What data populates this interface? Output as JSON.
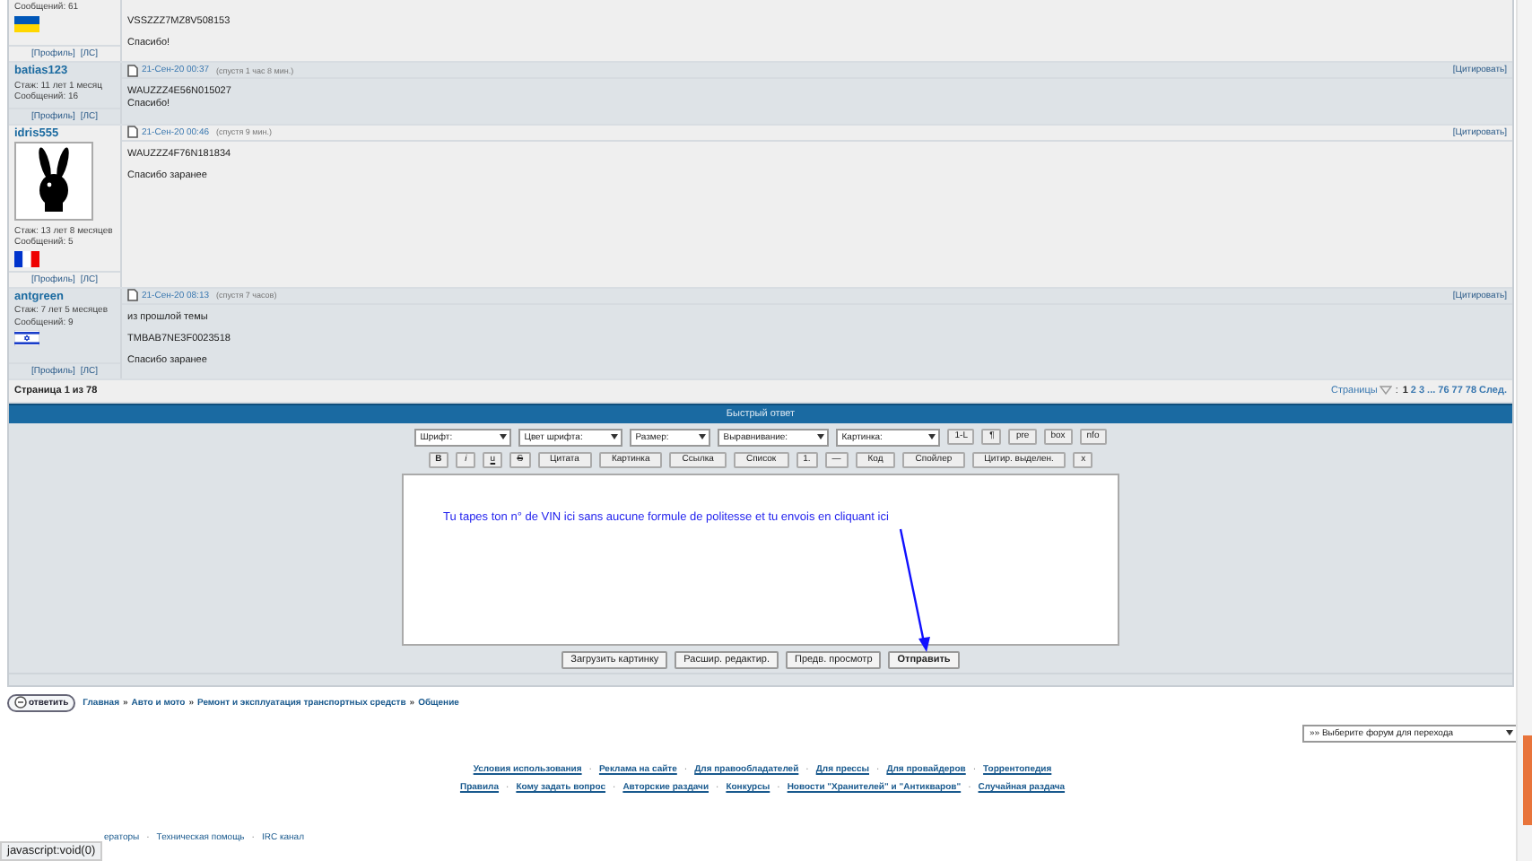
{
  "posts": [
    {
      "stats": [
        "Сообщений: 61"
      ],
      "flag": {
        "kind": "horizontal"
      },
      "profile_links": [
        "[Профиль]",
        "[ЛС]"
      ],
      "paragraphs": [
        "VSSZZZ7MZ8V508153",
        "Спасибо!"
      ]
    },
    {
      "author": "batias123",
      "date": "21-Сен-20 00:37",
      "ago": "(спустя 1 час 8 мин.)",
      "quote": "[Цитировать]",
      "stats": [
        "Стаж: 11 лет 1 месяц",
        "Сообщений: 16"
      ],
      "profile_links": [
        "[Профиль]",
        "[ЛС]"
      ],
      "paragraphs": [
        "WAUZZZ4E56N015027\nСпасибо!"
      ]
    },
    {
      "author": "idris555",
      "date": "21-Сен-20 00:46",
      "ago": "(спустя 9 мин.)",
      "quote": "[Цитировать]",
      "avatar": true,
      "stats": [
        "Стаж: 13 лет 8 месяцев",
        "Сообщений: 5"
      ],
      "flag": {
        "kind": "vertical"
      },
      "profile_links": [
        "[Профиль]",
        "[ЛС]"
      ],
      "paragraphs": [
        "WAUZZZ4F76N181834",
        "Спасибо заранее"
      ]
    },
    {
      "author": "antgreen",
      "date": "21-Сен-20 08:13",
      "ago": "(спустя 7 часов)",
      "quote": "[Цитировать]",
      "stats": [
        "Стаж: 7 лет 5 месяцев",
        "Сообщений: 9"
      ],
      "flag": {
        "kind": "star"
      },
      "profile_links": [
        "[Профиль]",
        "[ЛС]"
      ],
      "paragraphs": [
        "из прошлой темы",
        "TMBAB7NE3F0023518",
        "Спасибо заранее"
      ]
    }
  ],
  "pagination": {
    "page_info": "Страница 1 из 78",
    "label": "Страницы",
    "colon": ":",
    "pages": [
      {
        "label": "1",
        "selected": true
      },
      {
        "label": "2",
        "selected": false
      },
      {
        "label": "3",
        "selected": false
      },
      {
        "label": "...",
        "selected": false
      },
      {
        "label": "76",
        "selected": false
      },
      {
        "label": "77",
        "selected": false
      },
      {
        "label": "78",
        "selected": false
      },
      {
        "label": "След.",
        "selected": false
      }
    ]
  },
  "quick_reply": {
    "title": "Быстрый ответ",
    "selects": [
      "Шрифт:",
      "Цвет шрифта:",
      "Размер:",
      "Выравнивание:",
      "Картинка:"
    ],
    "row1_buttons": [
      "1-L",
      "¶",
      "pre",
      "box",
      "nfo"
    ],
    "row2_buttons": [
      "B",
      "i",
      "u",
      "S",
      "Цитата",
      "Картинка",
      "Ссылка",
      "Список",
      "1.",
      "—",
      "Код",
      "Спойлер",
      "Цитир. выделен.",
      "x"
    ],
    "annotation": "Tu tapes ton n° de VIN ici sans aucune formule de politesse et tu envois en cliquant ici",
    "action_buttons": [
      {
        "label": "Загрузить картинку",
        "primary": false
      },
      {
        "label": "Расшир. редактир.",
        "primary": false
      },
      {
        "label": "Предв. просмотр",
        "primary": false
      },
      {
        "label": "Отправить",
        "primary": true
      }
    ]
  },
  "breadcrumb": {
    "reply_button": "ответить",
    "separator": "»",
    "items": [
      "Главная",
      "Авто и мото",
      "Ремонт и эксплуатация транспортных средств",
      "Общение"
    ]
  },
  "forum_jump": "»» Выберите форум для перехода",
  "footer": {
    "separator": "·",
    "link_lines": [
      {
        "links": [
          "Условия использования",
          "Реклама на сайте",
          "Для правообладателей",
          "Для прессы",
          "Для провайдеров",
          "Торрентопедия"
        ]
      },
      {
        "links": [
          "Правила",
          "Кому задать вопрос",
          "Авторские раздачи",
          "Конкурсы",
          "Новости \"Хранителей\" и \"Антикваров\"",
          "Случайная раздача"
        ]
      }
    ],
    "bottom_links": [
      "ераторы",
      "Техническая помощь",
      "IRC канал"
    ]
  },
  "status_bar": "javascript:void(0)"
}
